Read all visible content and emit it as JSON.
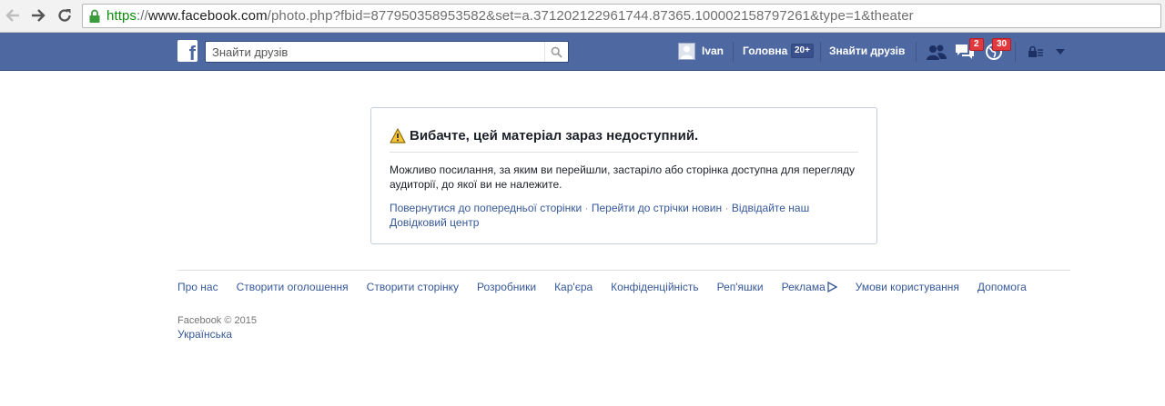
{
  "browser": {
    "url_scheme": "https",
    "url_separator": "://",
    "url_host": "www.facebook.com",
    "url_path": "/photo.php?fbid=877950358953582&set=a.371202122961744.87365.100002158797261&type=1&theater",
    "icons": {
      "back": "back-arrow-icon",
      "forward": "forward-arrow-icon",
      "reload": "reload-icon",
      "lock": "padlock-icon"
    }
  },
  "header": {
    "logo": "f",
    "search_placeholder": "Знайти друзів",
    "user_name": "Ivan",
    "home_label": "Головна",
    "home_count": "20+",
    "find_friends_label": "Знайти друзів",
    "friend_requests_icon": "friends-icon",
    "messages_count": "2",
    "notifications_count": "30",
    "privacy_icon": "lock-icon",
    "colors": {
      "bar": "#4e69a2",
      "badge": "#e0393e"
    }
  },
  "error": {
    "title": "Вибачте, цей матеріал зараз недоступний.",
    "body": "Можливо посилання, за яким ви перейшли, застаріло або сторінка доступна для перегляду аудиторії, до якої ви не належите.",
    "link_back": "Повернутися до попередньої сторінки",
    "link_feed": "Перейти до стрічки новин",
    "link_help": "Відвідайте наш Довідковий центр",
    "separator": "·"
  },
  "footer": {
    "links": [
      "Про нас",
      "Створити оголошення",
      "Створити сторінку",
      "Розробники",
      "Кар'єра",
      "Конфіденційність",
      "Реп'яшки",
      "Реклама",
      "Умови користування",
      "Допомога"
    ],
    "copyright": "Facebook © 2015",
    "language": "Українська"
  }
}
